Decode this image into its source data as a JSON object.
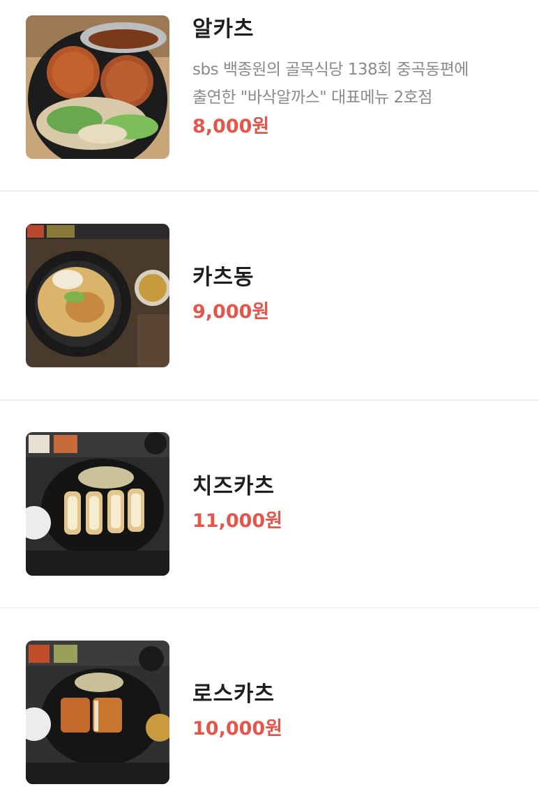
{
  "menu": {
    "items": [
      {
        "name": "알카츠",
        "description_line1": "sbs 백종원의 골목식당 138회 중곡동편에",
        "description_line2": "출연한 \"바삭알까스\" 대표메뉴 2호점",
        "price": "8,000원",
        "image_icon": "food-photo-icon"
      },
      {
        "name": "카츠동",
        "price": "9,000원",
        "image_icon": "food-photo-icon"
      },
      {
        "name": "치즈카츠",
        "price": "11,000원",
        "image_icon": "food-photo-icon"
      },
      {
        "name": "로스카츠",
        "price": "10,000원",
        "image_icon": "food-photo-icon"
      }
    ]
  },
  "colors": {
    "price": "#e5564a",
    "name": "#1e1e1e",
    "description": "#8a8a8a",
    "divider": "#efefef"
  }
}
